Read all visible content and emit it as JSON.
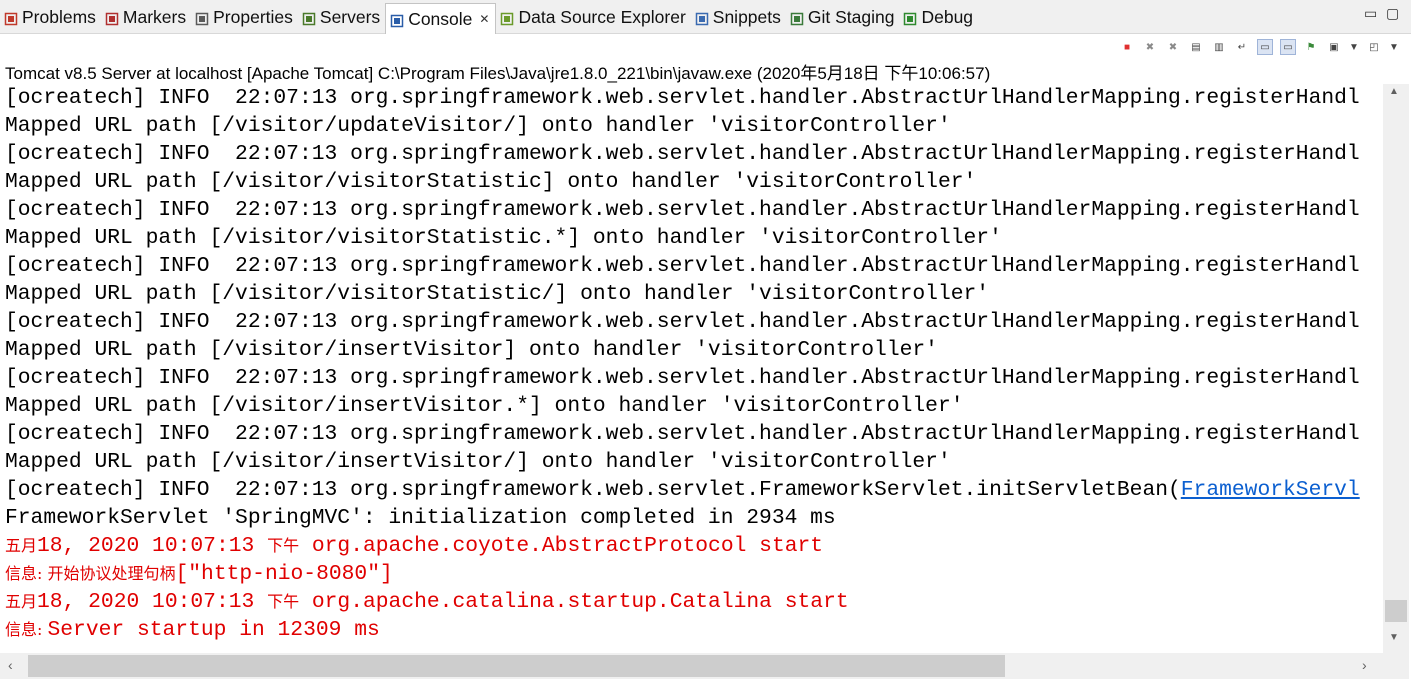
{
  "tabs": [
    {
      "label": "Problems",
      "icon": "problems-icon",
      "color": "#c0392b"
    },
    {
      "label": "Markers",
      "icon": "markers-icon",
      "color": "#b03030"
    },
    {
      "label": "Properties",
      "icon": "properties-icon",
      "color": "#5a5a5a"
    },
    {
      "label": "Servers",
      "icon": "servers-icon",
      "color": "#4a7a2a"
    },
    {
      "label": "Console",
      "icon": "console-icon",
      "color": "#2a5da8",
      "active": true
    },
    {
      "label": "Data Source Explorer",
      "icon": "datasource-icon",
      "color": "#6a9a2a"
    },
    {
      "label": "Snippets",
      "icon": "snippets-icon",
      "color": "#3a6ab0"
    },
    {
      "label": "Git Staging",
      "icon": "git-staging-icon",
      "color": "#3a7a3a"
    },
    {
      "label": "Debug",
      "icon": "debug-icon",
      "color": "#2f8a2f"
    }
  ],
  "process_label": "Tomcat v8.5 Server at localhost [Apache Tomcat] C:\\Program Files\\Java\\jre1.8.0_221\\bin\\javaw.exe  (2020年5月18日 下午10:06:57)",
  "toolbar_icons": [
    "terminate-icon",
    "remove-launch-icon",
    "remove-all-terminated-icon",
    "clear-console-icon",
    "scroll-lock-icon",
    "word-wrap-icon",
    "show-on-stdout-icon",
    "show-on-stderr-icon",
    "pin-console-icon",
    "display-console-icon",
    "display-console-dropdown-icon",
    "open-console-icon",
    "open-console-dropdown-icon"
  ],
  "console": {
    "lines": [
      {
        "segments": [
          {
            "t": "[ocreatech] INFO  22:07:13 org.springframework.web.servlet.handler.AbstractUrlHandlerMapping.registerHandl"
          }
        ]
      },
      {
        "segments": [
          {
            "t": "Mapped URL path [/visitor/updateVisitor/] onto handler 'visitorController'"
          }
        ]
      },
      {
        "segments": [
          {
            "t": "[ocreatech] INFO  22:07:13 org.springframework.web.servlet.handler.AbstractUrlHandlerMapping.registerHandl"
          }
        ]
      },
      {
        "segments": [
          {
            "t": "Mapped URL path [/visitor/visitorStatistic] onto handler 'visitorController'"
          }
        ]
      },
      {
        "segments": [
          {
            "t": "[ocreatech] INFO  22:07:13 org.springframework.web.servlet.handler.AbstractUrlHandlerMapping.registerHandl"
          }
        ]
      },
      {
        "segments": [
          {
            "t": "Mapped URL path [/visitor/visitorStatistic.*] onto handler 'visitorController'"
          }
        ]
      },
      {
        "segments": [
          {
            "t": "[ocreatech] INFO  22:07:13 org.springframework.web.servlet.handler.AbstractUrlHandlerMapping.registerHandl"
          }
        ]
      },
      {
        "segments": [
          {
            "t": "Mapped URL path [/visitor/visitorStatistic/] onto handler 'visitorController'"
          }
        ]
      },
      {
        "segments": [
          {
            "t": "[ocreatech] INFO  22:07:13 org.springframework.web.servlet.handler.AbstractUrlHandlerMapping.registerHandl"
          }
        ]
      },
      {
        "segments": [
          {
            "t": "Mapped URL path [/visitor/insertVisitor] onto handler 'visitorController'"
          }
        ]
      },
      {
        "segments": [
          {
            "t": "[ocreatech] INFO  22:07:13 org.springframework.web.servlet.handler.AbstractUrlHandlerMapping.registerHandl"
          }
        ]
      },
      {
        "segments": [
          {
            "t": "Mapped URL path [/visitor/insertVisitor.*] onto handler 'visitorController'"
          }
        ]
      },
      {
        "segments": [
          {
            "t": "[ocreatech] INFO  22:07:13 org.springframework.web.servlet.handler.AbstractUrlHandlerMapping.registerHandl"
          }
        ]
      },
      {
        "segments": [
          {
            "t": "Mapped URL path [/visitor/insertVisitor/] onto handler 'visitorController'"
          }
        ]
      },
      {
        "segments": [
          {
            "t": "[ocreatech] INFO  22:07:13 org.springframework.web.servlet.FrameworkServlet.initServletBean("
          },
          {
            "t": "FrameworkServl",
            "link": true
          }
        ]
      },
      {
        "segments": [
          {
            "t": "FrameworkServlet 'SpringMVC': initialization completed in 2934 ms"
          }
        ]
      },
      {
        "stream": "err",
        "segments": [
          {
            "t": "五月",
            "zh": true
          },
          {
            "t": "18, 2020 10:07:13 "
          },
          {
            "t": "下午",
            "zh": true
          },
          {
            "t": " org.apache.coyote.AbstractProtocol start"
          }
        ]
      },
      {
        "stream": "err",
        "segments": [
          {
            "t": "信息: 开始协议处理句柄",
            "zh": true
          },
          {
            "t": "[\"http-nio-8080\"]"
          }
        ]
      },
      {
        "stream": "err",
        "segments": [
          {
            "t": "五月",
            "zh": true
          },
          {
            "t": "18, 2020 10:07:13 "
          },
          {
            "t": "下午",
            "zh": true
          },
          {
            "t": " org.apache.catalina.startup.Catalina start"
          }
        ]
      },
      {
        "stream": "err",
        "segments": [
          {
            "t": "信息: ",
            "zh": true
          },
          {
            "t": "Server startup in 12309 ms"
          }
        ]
      }
    ]
  },
  "colors": {
    "stdout": "#000000",
    "stderr": "#e00000",
    "link": "#0b5fd0",
    "panel_bg": "#f0f0f0"
  }
}
